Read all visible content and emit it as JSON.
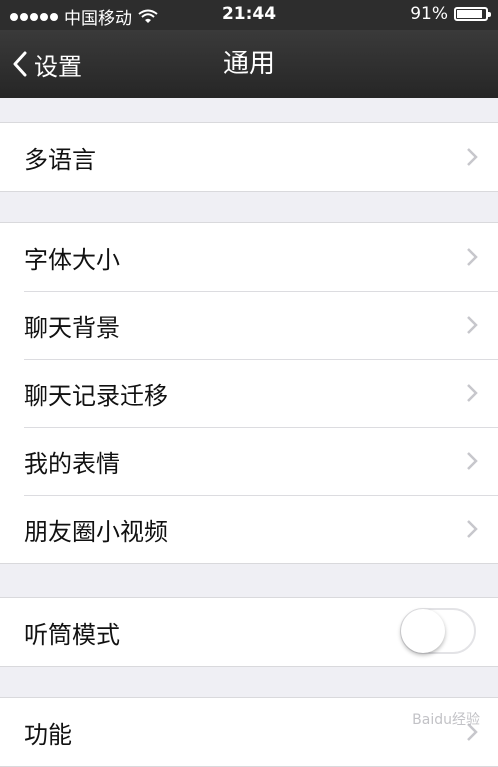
{
  "status_bar": {
    "carrier": "中国移动",
    "time": "21:44",
    "battery_percent": "91%",
    "battery_level": 0.91,
    "signal_dots": 5
  },
  "nav": {
    "back_label": "设置",
    "title": "通用"
  },
  "groups": [
    {
      "items": [
        {
          "label": "多语言",
          "accessory": "chevron-right-icon"
        }
      ]
    },
    {
      "items": [
        {
          "label": "字体大小",
          "accessory": "chevron-right-icon"
        },
        {
          "label": "聊天背景",
          "accessory": "chevron-right-icon"
        },
        {
          "label": "聊天记录迁移",
          "accessory": "chevron-right-icon"
        },
        {
          "label": "我的表情",
          "accessory": "chevron-right-icon"
        },
        {
          "label": "朋友圈小视频",
          "accessory": "chevron-right-icon"
        }
      ]
    },
    {
      "items": [
        {
          "label": "听筒模式",
          "accessory": "toggle",
          "toggle_on": false
        }
      ]
    },
    {
      "items": [
        {
          "label": "功能",
          "accessory": "chevron-right-icon"
        }
      ]
    }
  ],
  "watermark": "Baidu经验",
  "colors": {
    "background": "#efeff4",
    "nav_bar": "#2d2d2d",
    "chevron": "#c7c7cc"
  }
}
